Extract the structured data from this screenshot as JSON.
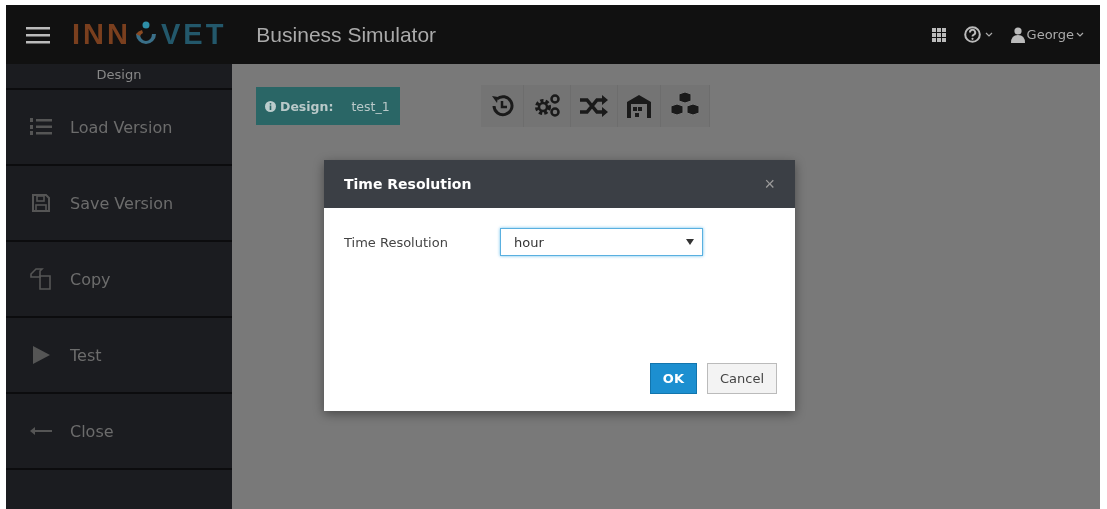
{
  "header": {
    "logo": {
      "left": "INN",
      "right": "VET"
    },
    "title": "Business Simulator",
    "user": "George"
  },
  "sidebar": {
    "heading": "Design",
    "items": [
      {
        "label": "Load Version"
      },
      {
        "label": "Save Version"
      },
      {
        "label": "Copy"
      },
      {
        "label": "Test"
      },
      {
        "label": "Close"
      }
    ]
  },
  "design_badge": {
    "label": "Design:",
    "value": "test_1"
  },
  "dialog": {
    "title": "Time Resolution",
    "close": "×",
    "field_label": "Time Resolution",
    "value": "hour",
    "buttons": [
      {
        "label": "OK",
        "kind": "primary"
      },
      {
        "label": "Cancel",
        "kind": "default"
      }
    ]
  }
}
